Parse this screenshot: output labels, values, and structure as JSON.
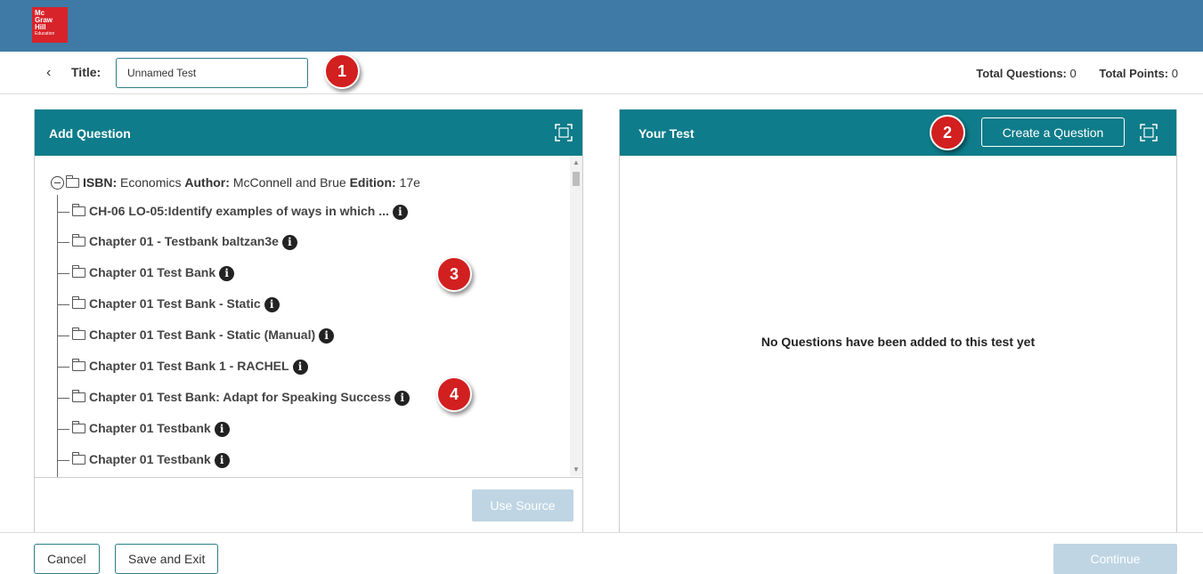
{
  "brand": {
    "logo_line1": "Mc",
    "logo_line2": "Graw",
    "logo_line3": "Hill",
    "logo_line4": "Education",
    "bar_color": "#3f7aa6",
    "logo_color": "#d8232a"
  },
  "header": {
    "back_glyph": "‹",
    "title_label": "Title:",
    "title_value": "Unnamed Test",
    "total_questions_label": "Total Questions:",
    "total_questions_value": "0",
    "total_points_label": "Total Points:",
    "total_points_value": "0"
  },
  "callouts": [
    "1",
    "2",
    "3",
    "4"
  ],
  "left_panel": {
    "title": "Add Question",
    "root": {
      "isbn_label": "ISBN:",
      "isbn_value": "Economics",
      "author_label": "Author:",
      "author_value": "McConnell and Brue",
      "edition_label": "Edition:",
      "edition_value": "17e"
    },
    "items": [
      "CH-06 LO-05:Identify examples of ways in which ...",
      "Chapter 01 - Testbank baltzan3e",
      "Chapter 01 Test Bank",
      "Chapter 01 Test Bank - Static",
      "Chapter 01 Test Bank - Static (Manual)",
      "Chapter 01 Test Bank 1 - RACHEL",
      "Chapter 01 Test Bank: Adapt for Speaking Success",
      "Chapter 01 Testbank",
      "Chapter 01 Testbank"
    ],
    "use_source_label": "Use Source"
  },
  "right_panel": {
    "title": "Your Test",
    "create_question_label": "Create a Question",
    "empty_message": "No Questions have been added to this test yet"
  },
  "footer": {
    "cancel_label": "Cancel",
    "save_exit_label": "Save and Exit",
    "continue_label": "Continue"
  },
  "colors": {
    "panel_header": "#0e7c8a",
    "badge": "#d21f1f",
    "disabled_button": "#bfd5e3"
  },
  "icons": {
    "info": "info-circle-icon",
    "folder": "folder-icon",
    "expand": "expand-icon",
    "collapse": "minus-circle-icon"
  }
}
